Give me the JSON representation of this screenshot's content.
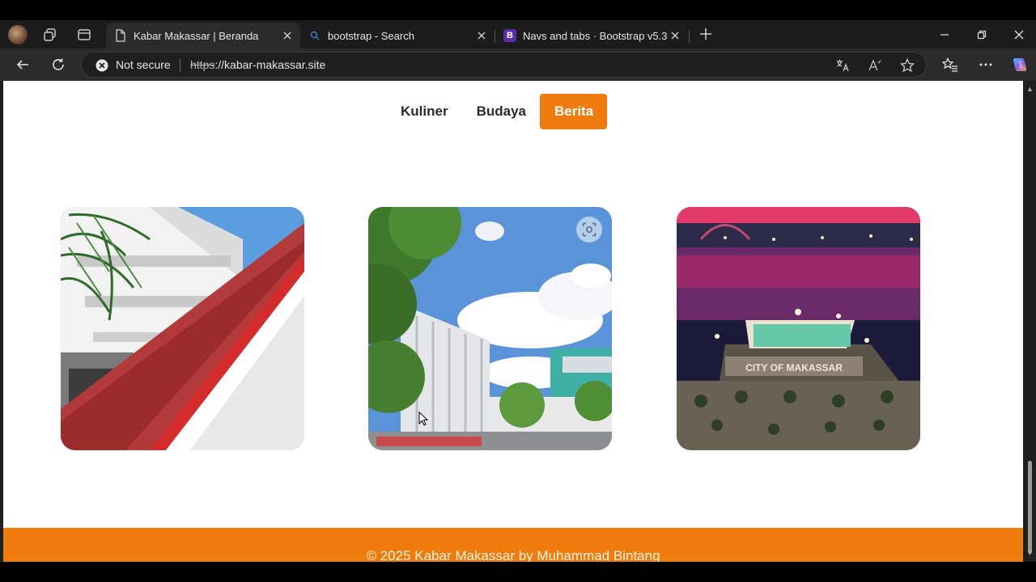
{
  "tabs": [
    {
      "title": "Kabar Makassar | Beranda",
      "favicon": "page-icon",
      "active": true
    },
    {
      "title": "bootstrap - Search",
      "favicon": "search-icon",
      "active": false
    },
    {
      "title": "Navs and tabs · Bootstrap v5.3",
      "favicon": "B",
      "active": false
    }
  ],
  "address_bar": {
    "security_text": "Not secure",
    "url_scheme": "https",
    "url_rest": "://kabar-makassar.site"
  },
  "page": {
    "nav_pills": [
      {
        "label": "Kuliner",
        "active": false
      },
      {
        "label": "Budaya",
        "active": false
      },
      {
        "label": "Berita",
        "active": true
      }
    ],
    "cards": [
      {
        "image": "building-red-roof-photo"
      },
      {
        "image": "campus-building-sky-photo"
      },
      {
        "image": "city-of-makassar-night-photo",
        "sign_text": "CITY OF MAKASSAR"
      }
    ],
    "footer_text": "© 2025 Kabar Makassar by Muhammad Bintang"
  },
  "colors": {
    "accent": "#f07c0e",
    "browser_dark": "#2b2b2b",
    "page_bg": "#ffffff"
  }
}
